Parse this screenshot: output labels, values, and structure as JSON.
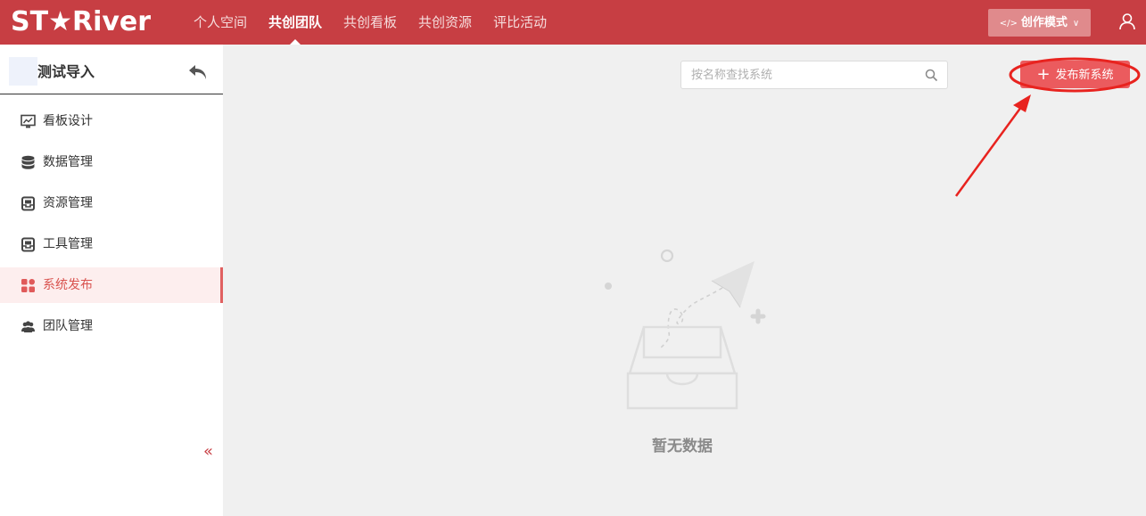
{
  "header": {
    "logo_text": "ST★River",
    "nav": [
      {
        "label": "个人空间",
        "active": false
      },
      {
        "label": "共创团队",
        "active": true
      },
      {
        "label": "共创看板",
        "active": false
      },
      {
        "label": "共创资源",
        "active": false
      },
      {
        "label": "评比活动",
        "active": false
      }
    ],
    "mode_button": {
      "code_glyph": "</>",
      "label": "创作模式"
    },
    "user_icon": "user-icon",
    "colors": {
      "bar": "#c73e43",
      "accent": "#eb5b5e"
    }
  },
  "sidebar": {
    "title": "测试导入",
    "back_icon": "undo-arrow-icon",
    "items": [
      {
        "label": "看板设计",
        "icon": "chart-monitor-icon",
        "active": false
      },
      {
        "label": "数据管理",
        "icon": "database-icon",
        "active": false
      },
      {
        "label": "资源管理",
        "icon": "drawer-icon",
        "active": false
      },
      {
        "label": "工具管理",
        "icon": "drawer-icon",
        "active": false
      },
      {
        "label": "系统发布",
        "icon": "apps-grid-icon",
        "active": true
      },
      {
        "label": "团队管理",
        "icon": "team-icon",
        "active": false
      }
    ],
    "collapse_glyph": "«"
  },
  "main": {
    "search": {
      "placeholder": "按名称查找系统",
      "value": ""
    },
    "publish_button": {
      "plus": "+",
      "label": "发布新系统"
    },
    "empty_state": {
      "text": "暂无数据",
      "icon": "empty-box-paper-plane-icon"
    }
  }
}
